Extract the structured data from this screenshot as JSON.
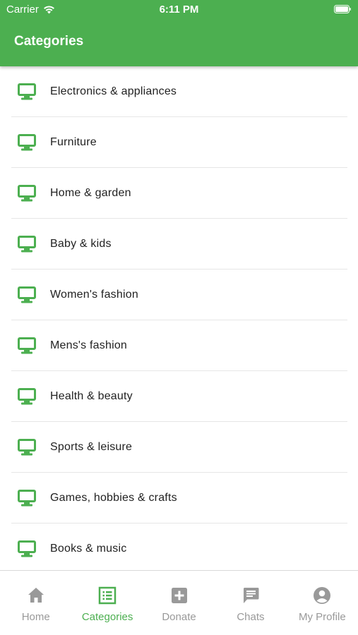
{
  "status_bar": {
    "carrier": "Carrier",
    "time": "6:11 PM"
  },
  "header": {
    "title": "Categories"
  },
  "categories": [
    {
      "label": "Electronics & appliances",
      "icon": "monitor-icon"
    },
    {
      "label": "Furniture",
      "icon": "monitor-icon"
    },
    {
      "label": "Home & garden",
      "icon": "monitor-icon"
    },
    {
      "label": "Baby & kids",
      "icon": "monitor-icon"
    },
    {
      "label": "Women's fashion",
      "icon": "monitor-icon"
    },
    {
      "label": "Mens's fashion",
      "icon": "monitor-icon"
    },
    {
      "label": "Health & beauty",
      "icon": "monitor-icon"
    },
    {
      "label": "Sports & leisure",
      "icon": "monitor-icon"
    },
    {
      "label": "Games, hobbies & crafts",
      "icon": "monitor-icon"
    },
    {
      "label": "Books & music",
      "icon": "monitor-icon"
    }
  ],
  "tabbar": {
    "tabs": [
      {
        "label": "Home",
        "icon": "home-icon",
        "active": false
      },
      {
        "label": "Categories",
        "icon": "list-icon",
        "active": true
      },
      {
        "label": "Donate",
        "icon": "plus-box-icon",
        "active": false
      },
      {
        "label": "Chats",
        "icon": "chat-icon",
        "active": false
      },
      {
        "label": "My Profile",
        "icon": "profile-icon",
        "active": false
      }
    ]
  },
  "colors": {
    "accent": "#4caf50",
    "inactive": "#999999",
    "text": "#222222"
  }
}
